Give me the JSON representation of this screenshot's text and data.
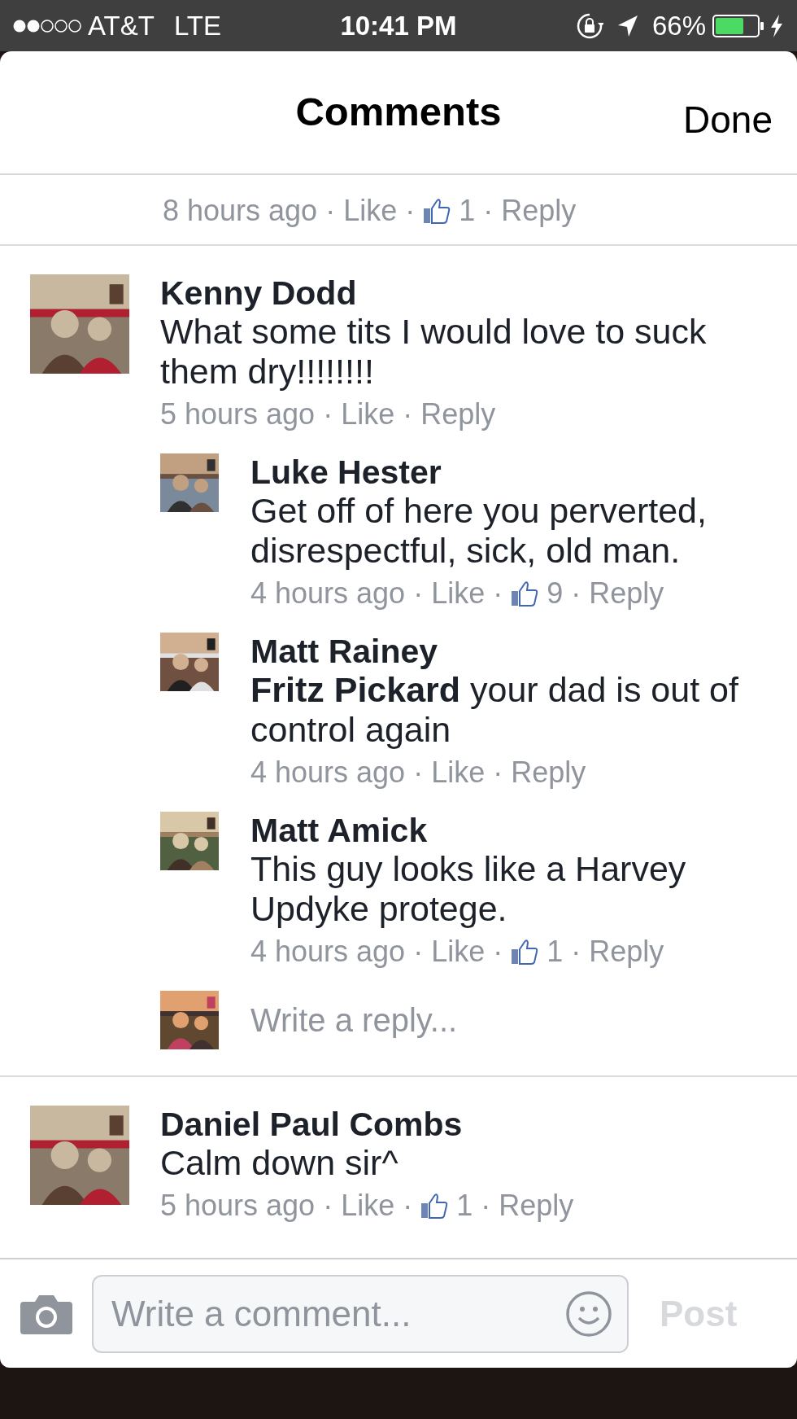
{
  "status_bar": {
    "carrier": "AT&T",
    "network": "LTE",
    "time": "10:41 PM",
    "battery": "66%"
  },
  "header": {
    "title": "Comments",
    "done": "Done"
  },
  "previous_meta": [
    {
      "kind": "time",
      "text": "8 hours ago"
    },
    {
      "kind": "dot",
      "text": "·"
    },
    {
      "kind": "like",
      "text": "Like"
    },
    {
      "kind": "dot",
      "text": "·"
    },
    {
      "kind": "count",
      "text": "1"
    },
    {
      "kind": "dot",
      "text": "·"
    },
    {
      "kind": "reply",
      "text": "Reply"
    }
  ],
  "comments": [
    {
      "name": "Kenny Dodd",
      "text": "What some tits I would love to suck them dry!!!!!!!!",
      "meta": [
        {
          "kind": "time",
          "text": "5 hours ago"
        },
        {
          "kind": "dot",
          "text": "·"
        },
        {
          "kind": "like",
          "text": "Like"
        },
        {
          "kind": "dot",
          "text": "·"
        },
        {
          "kind": "reply",
          "text": "Reply"
        }
      ],
      "replies": [
        {
          "name": "Luke Hester",
          "text": "Get off of here you perverted, disrespectful, sick, old man.",
          "meta": [
            {
              "kind": "time",
              "text": "4 hours ago"
            },
            {
              "kind": "dot",
              "text": "·"
            },
            {
              "kind": "like",
              "text": "Like"
            },
            {
              "kind": "dot",
              "text": "·"
            },
            {
              "kind": "count",
              "text": "9"
            },
            {
              "kind": "dot",
              "text": "·"
            },
            {
              "kind": "reply",
              "text": "Reply"
            }
          ]
        },
        {
          "name": "Matt Rainey",
          "text": "**Fritz Pickard** your dad is out of control again",
          "meta": [
            {
              "kind": "time",
              "text": "4 hours ago"
            },
            {
              "kind": "dot",
              "text": "·"
            },
            {
              "kind": "like",
              "text": "Like"
            },
            {
              "kind": "dot",
              "text": "·"
            },
            {
              "kind": "reply",
              "text": "Reply"
            }
          ]
        },
        {
          "name": "Matt Amick",
          "text": "This guy looks like a Harvey Updyke protege.",
          "meta": [
            {
              "kind": "time",
              "text": "4 hours ago"
            },
            {
              "kind": "dot",
              "text": "·"
            },
            {
              "kind": "like",
              "text": "Like"
            },
            {
              "kind": "dot",
              "text": "·"
            },
            {
              "kind": "count",
              "text": "1"
            },
            {
              "kind": "dot",
              "text": "·"
            },
            {
              "kind": "reply",
              "text": "Reply"
            }
          ]
        }
      ],
      "reply_placeholder": "Write a reply..."
    },
    {
      "name": "Daniel Paul Combs",
      "text": "Calm down sir^",
      "meta": [
        {
          "kind": "time",
          "text": "5 hours ago"
        },
        {
          "kind": "dot",
          "text": "·"
        },
        {
          "kind": "like",
          "text": "Like"
        },
        {
          "kind": "dot",
          "text": "·"
        },
        {
          "kind": "count",
          "text": "1"
        },
        {
          "kind": "dot",
          "text": "·"
        },
        {
          "kind": "reply",
          "text": "Reply"
        }
      ]
    }
  ],
  "composer": {
    "placeholder": "Write a comment...",
    "post": "Post",
    "post_disabled": true
  }
}
